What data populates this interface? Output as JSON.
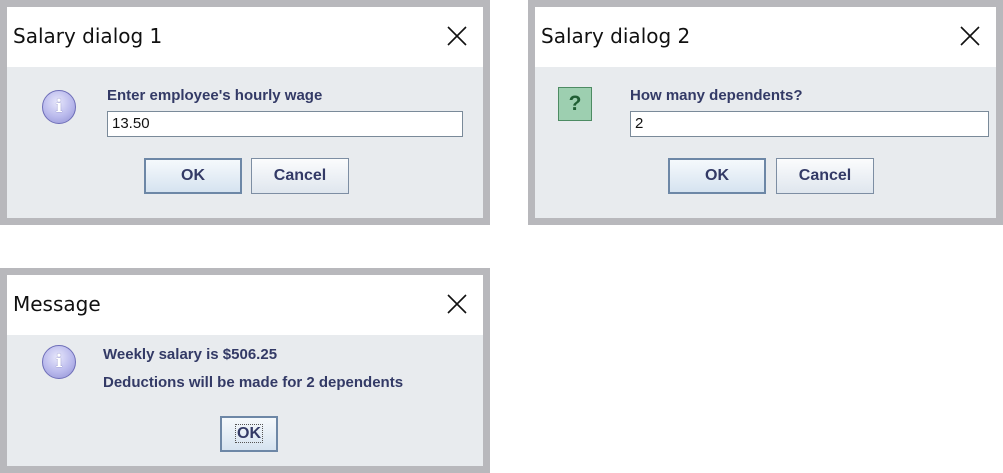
{
  "dialogs": {
    "salary1": {
      "title": "Salary dialog 1",
      "icon": "information-icon",
      "prompt": "Enter employee's hourly wage",
      "input_value": "13.50",
      "ok_label": "OK",
      "cancel_label": "Cancel"
    },
    "salary2": {
      "title": "Salary dialog 2",
      "icon": "question-icon",
      "prompt": "How many dependents?",
      "input_value": "2",
      "ok_label": "OK",
      "cancel_label": "Cancel"
    },
    "message": {
      "title": "Message",
      "icon": "information-icon",
      "line1": "Weekly salary is $506.25",
      "line2": "Deductions will be made for 2 dependents",
      "ok_label": "OK"
    }
  },
  "close_glyph": "close-icon",
  "info_glyph": "i",
  "question_glyph": "?",
  "colors": {
    "frame": "#b8b8bc",
    "dialog_bg": "#e8ebee",
    "label_text": "#333a66",
    "info_icon": "#b9b9ec",
    "question_icon": "#9dcfb0"
  }
}
